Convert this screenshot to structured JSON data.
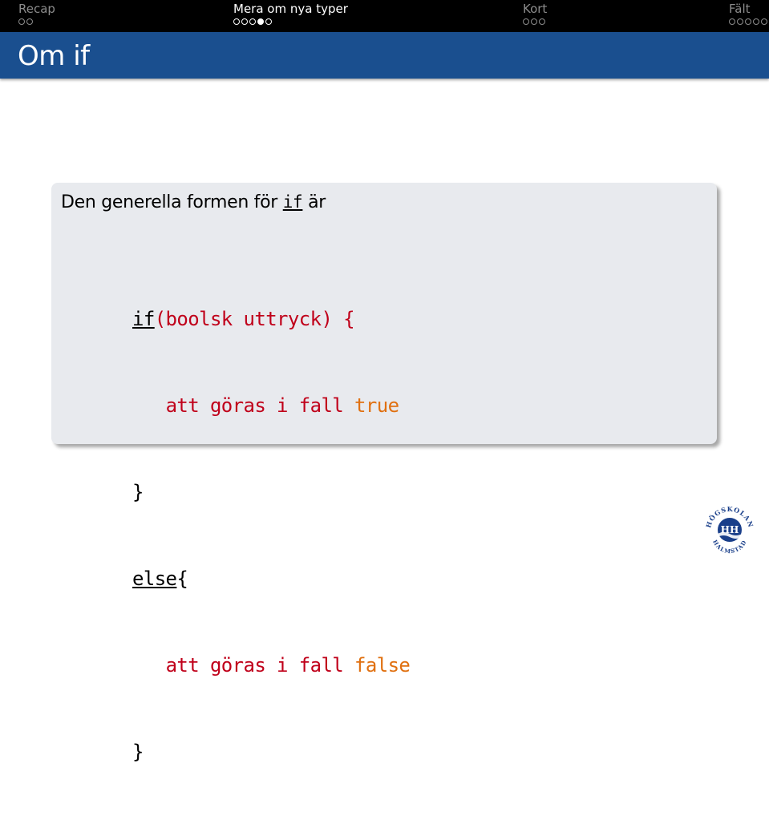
{
  "nav": {
    "sections": [
      {
        "label": "Recap"
      },
      {
        "label": "Mera om nya typer"
      },
      {
        "label": "Kort"
      },
      {
        "label": "Fält"
      }
    ]
  },
  "frame": {
    "title": "Om if"
  },
  "block": {
    "intro_text": "Den generella formen för",
    "intro_keyword": "if",
    "intro_suffix": "är",
    "code": {
      "if_kw": "if",
      "condition": "(boolsk uttryck) {",
      "true_action": "att göras i fall",
      "true_value": "true",
      "close1": "}",
      "else_kw": "else",
      "else_brace": "{",
      "false_action": "att göras i fall",
      "false_value": "false",
      "close2": "}"
    }
  },
  "logo": {
    "text_top": "HÖGSKOLAN",
    "text_bottom": "HALMSTAD",
    "monogram": "HH"
  },
  "colors": {
    "navbar": "#000000",
    "titlebar": "#1a4f8f",
    "block_bg": "#e8eaee",
    "code_red": "#c0001a",
    "code_orange": "#e07010"
  }
}
